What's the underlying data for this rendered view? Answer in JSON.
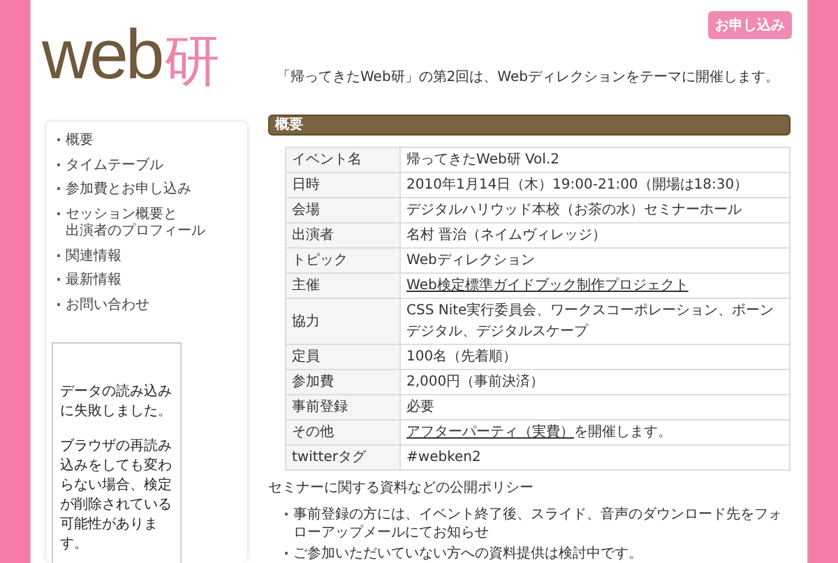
{
  "logo": {
    "word": "web",
    "mark": "研"
  },
  "apply_button": "お申し込み",
  "intro": "「帰ってきたWeb研」の第2回は、Webディレクションをテーマに開催します。",
  "sidebar": {
    "items": [
      {
        "label": "概要"
      },
      {
        "label": "タイムテーブル"
      },
      {
        "label": "参加費とお申し込み"
      },
      {
        "label": "セッション概要と",
        "continuation": "出演者のプロフィール"
      },
      {
        "label": "関連情報"
      },
      {
        "label": "最新情報"
      },
      {
        "label": "お問い合わせ"
      }
    ],
    "widget_message": [
      "データの読み込みに失敗しました。",
      "ブラウザの再読み込みをしても変わらない場合、検定が削除されている可能性があります。"
    ]
  },
  "section_title": "概要",
  "table": {
    "rows": [
      {
        "label": "イベント名",
        "value": [
          {
            "text": "帰ってきたWeb研 Vol.2",
            "link": false
          }
        ]
      },
      {
        "label": "日時",
        "value": [
          {
            "text": "2010年1月14日（木）19:00-21:00（開場は18:30）",
            "link": false
          }
        ]
      },
      {
        "label": "会場",
        "value": [
          {
            "text": "デジタルハリウッド本校（お茶の水）セミナーホール",
            "link": false
          }
        ]
      },
      {
        "label": "出演者",
        "value": [
          {
            "text": "名村 晋治（ネイムヴィレッジ）",
            "link": false
          }
        ]
      },
      {
        "label": "トピック",
        "value": [
          {
            "text": "Webディレクション",
            "link": false
          }
        ]
      },
      {
        "label": "主催",
        "value": [
          {
            "text": "Web検定標準ガイドブック制作プロジェクト",
            "link": true
          }
        ]
      },
      {
        "label": "協力",
        "value": [
          {
            "text": "CSS Nite実行委員会、ワークスコーポレーション、ボーンデジタル、デジタルスケープ",
            "link": false
          }
        ]
      },
      {
        "label": "定員",
        "value": [
          {
            "text": "100名（先着順）",
            "link": false
          }
        ]
      },
      {
        "label": "参加費",
        "value": [
          {
            "text": "2,000円（事前決済）",
            "link": false
          }
        ]
      },
      {
        "label": "事前登録",
        "value": [
          {
            "text": "必要",
            "link": false
          }
        ]
      },
      {
        "label": "その他",
        "value": [
          {
            "text": "アフターパーティ（実費）",
            "link": true
          },
          {
            "text": "を開催します。",
            "link": false
          }
        ]
      },
      {
        "label": "twitterタグ",
        "value": [
          {
            "text": "#webken2",
            "link": false
          }
        ]
      }
    ]
  },
  "policy": {
    "title": "セミナーに関する資料などの公開ポリシー",
    "items": [
      "事前登録の方には、イベント終了後、スライド、音声のダウンロード先をフォローアップメールにてお知らせ",
      "ご参加いただいていない方への資料提供は検討中です。"
    ]
  }
}
